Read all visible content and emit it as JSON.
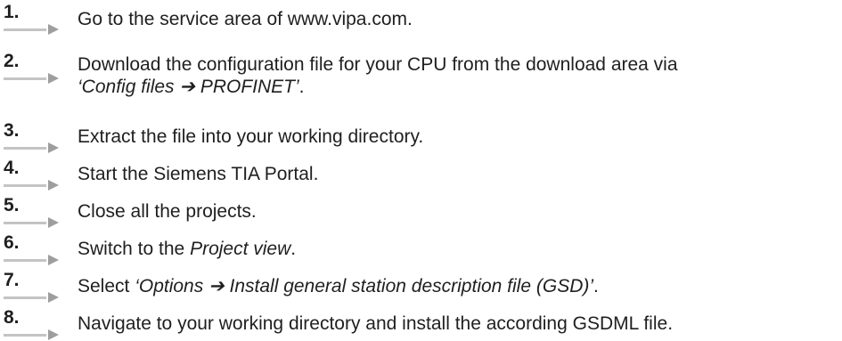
{
  "steps": [
    {
      "number": "1.",
      "segments": [
        {
          "text": "Go to the service area of www.vipa.com.",
          "italic": false
        }
      ]
    },
    {
      "number": "2.",
      "segments": [
        {
          "text": "Download the configuration file for your CPU from the download area via",
          "italic": false
        },
        {
          "text": "‘Config files ➔ PROFINET’",
          "italic": true,
          "newline": true
        },
        {
          "text": ".",
          "italic": false
        }
      ]
    },
    {
      "number": "3.",
      "segments": [
        {
          "text": "Extract the file into your working directory.",
          "italic": false
        }
      ]
    },
    {
      "number": "4.",
      "segments": [
        {
          "text": "Start the Siemens TIA Portal.",
          "italic": false
        }
      ]
    },
    {
      "number": "5.",
      "segments": [
        {
          "text": "Close all the projects.",
          "italic": false
        }
      ]
    },
    {
      "number": "6.",
      "segments": [
        {
          "text": "Switch to the ",
          "italic": false
        },
        {
          "text": "Project view",
          "italic": true
        },
        {
          "text": ".",
          "italic": false
        }
      ]
    },
    {
      "number": "7.",
      "segments": [
        {
          "text": "Select ",
          "italic": false
        },
        {
          "text": "‘Options ➔ Install general station description file (GSD)’",
          "italic": true
        },
        {
          "text": ".",
          "italic": false
        }
      ]
    },
    {
      "number": "8.",
      "segments": [
        {
          "text": "Navigate to your working directory and install the according GSDML file.",
          "italic": false
        }
      ]
    }
  ],
  "icons": {
    "step_marker": "step-arrow-icon"
  },
  "colors": {
    "text": "#1f1f1f",
    "marker_line": "#c4c4c4",
    "marker_arrow": "#9e9e9e"
  }
}
